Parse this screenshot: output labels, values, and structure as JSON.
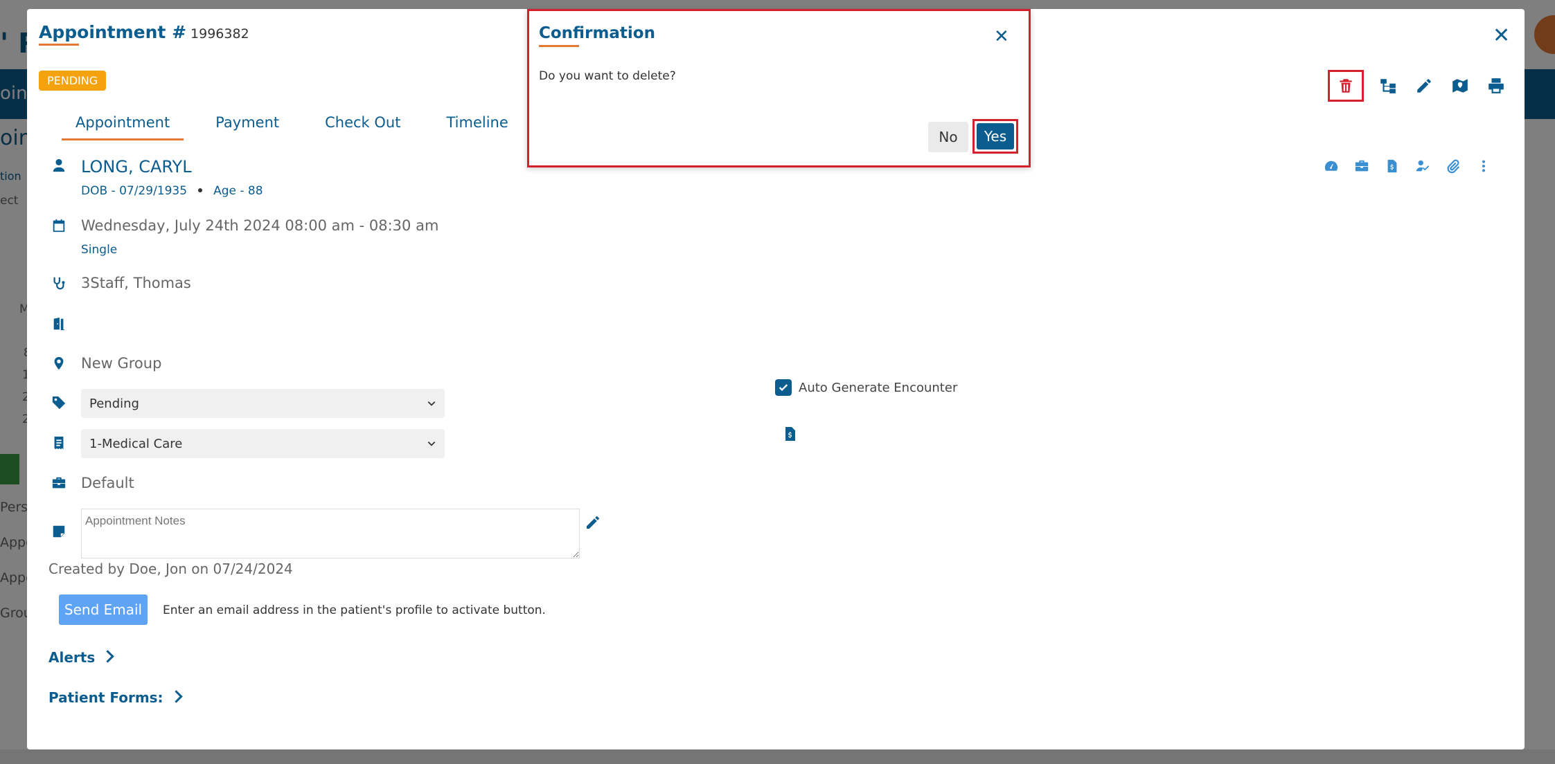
{
  "background": {
    "logo_fragment": "' R",
    "nav_fragment": "oin",
    "side_fragments": [
      "oint",
      "tion",
      "ect",
      "M",
      "8",
      "1",
      "2",
      "2",
      "Perso",
      "Appo",
      "Appo",
      "Grou"
    ]
  },
  "modal": {
    "title": "Appointment #",
    "appointment_number": "1996382",
    "status_badge": "PENDING",
    "tabs": [
      {
        "label": "Appointment",
        "active": true
      },
      {
        "label": "Payment",
        "active": false
      },
      {
        "label": "Check Out",
        "active": false
      },
      {
        "label": "Timeline",
        "active": false
      }
    ],
    "toolbar_icons": [
      "trash-icon",
      "sitemap-icon",
      "pencil-icon",
      "map-marker-icon",
      "print-icon"
    ],
    "mini_icons": [
      "dashboard-icon",
      "briefcase-icon",
      "file-invoice-icon",
      "user-check-icon",
      "paperclip-icon",
      "more-vertical-icon"
    ],
    "patient": {
      "name": "LONG, CARYL",
      "dob": "DOB - 07/29/1935",
      "age": "Age - 88"
    },
    "schedule": {
      "datetime": "Wednesday, July 24th 2024 08:00 am - 08:30 am",
      "recurrence": "Single"
    },
    "provider": "3Staff, Thomas",
    "location": "New Group",
    "status_select": "Pending",
    "visit_type_select": "1-Medical Care",
    "case": "Default",
    "notes_placeholder": "Appointment Notes",
    "auto_generate": {
      "label": "Auto Generate Encounter",
      "checked": true
    },
    "created_by": "Created by Doe, Jon on 07/24/2024",
    "send_email_label": "Send Email",
    "send_email_hint": "Enter an email address in the patient's profile to activate button.",
    "alerts_label": "Alerts",
    "patient_forms_label": "Patient Forms:"
  },
  "confirm": {
    "title": "Confirmation",
    "message": "Do you want to delete?",
    "no_label": "No",
    "yes_label": "Yes"
  },
  "colors": {
    "primary": "#0b5c8f",
    "accent": "#e47935",
    "pending": "#f5a20f",
    "highlight": "#d4212d",
    "send_button": "#5ea3f4"
  }
}
